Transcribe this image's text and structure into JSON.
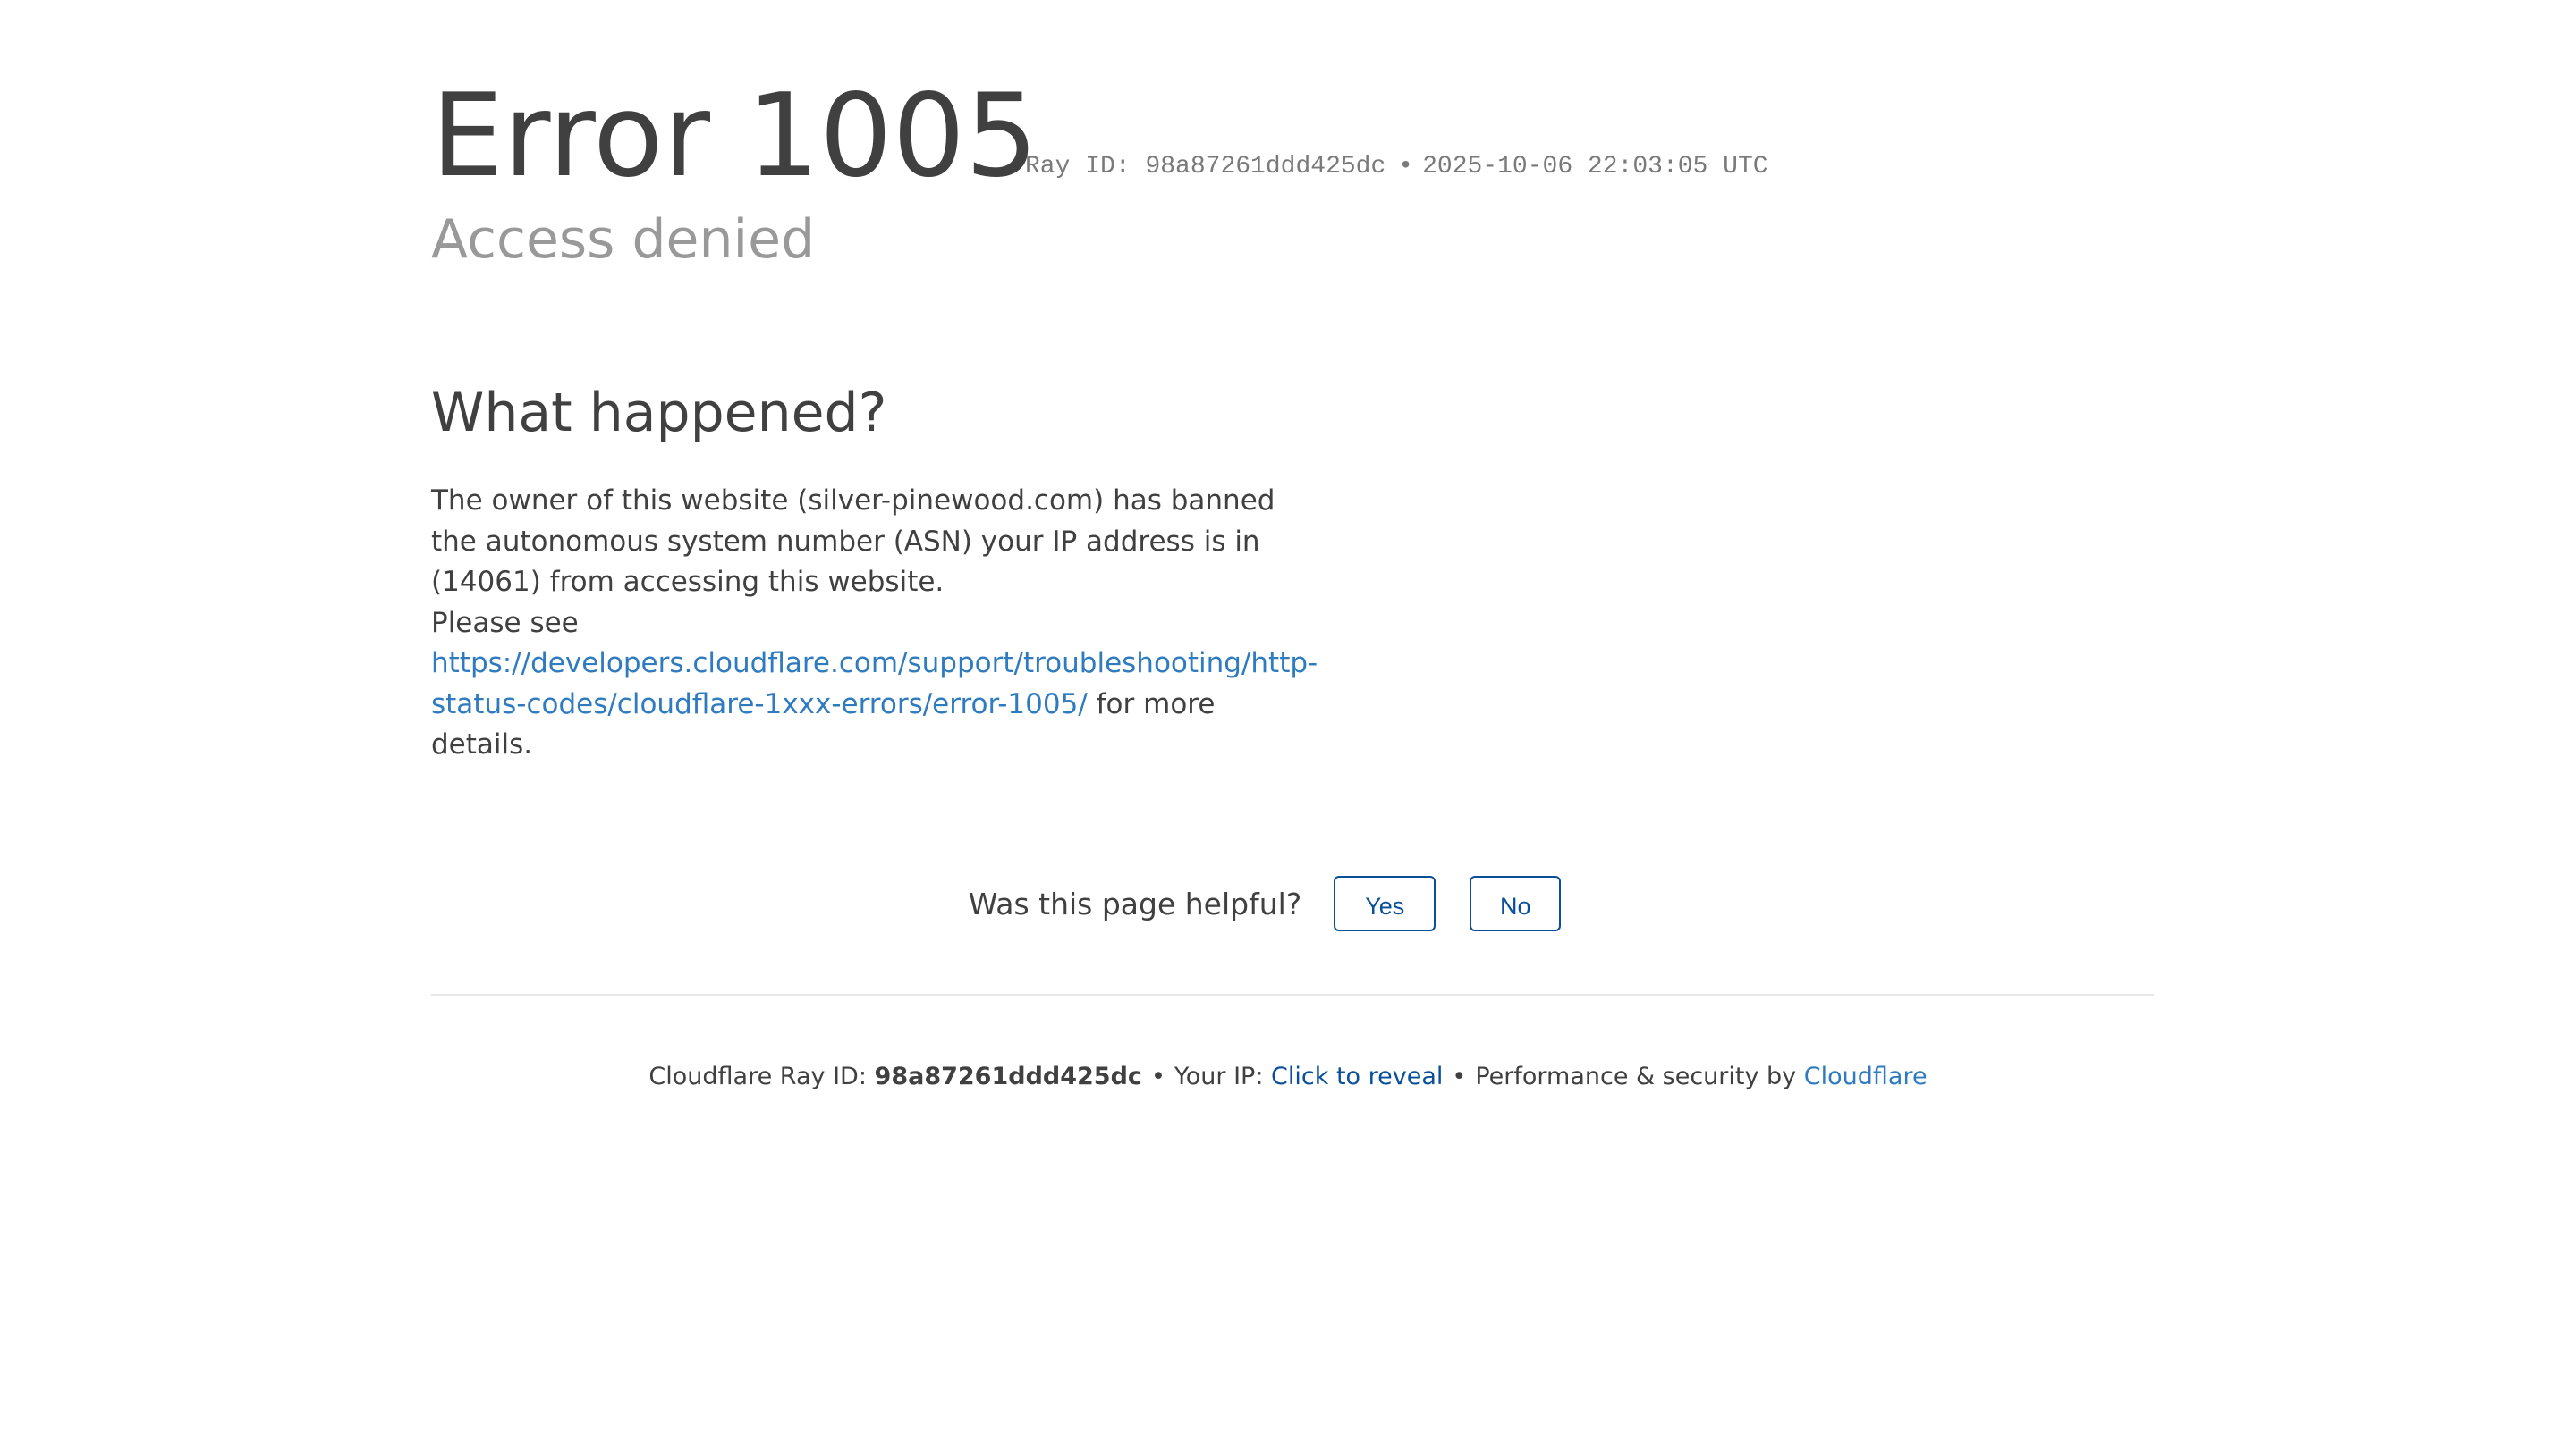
{
  "header": {
    "title": "Error 1005",
    "ray_label": "Ray ID:",
    "ray_id": "98a87261ddd425dc",
    "separator": "•",
    "timestamp": "2025-10-06 22:03:05 UTC",
    "subtitle": "Access denied"
  },
  "what_happened": {
    "heading": "What happened?",
    "paragraph": "The owner of this website (silver-pinewood.com) has banned the autonomous system number (ASN) your IP address is in (14061) from accessing this website.",
    "please_see": "Please see",
    "link_text": "https://developers.cloudflare.com/support/troubleshooting/http-status-codes/cloudflare-1xxx-errors/error-1005/",
    "after_link": "for more details."
  },
  "feedback": {
    "question": "Was this page helpful?",
    "yes_label": "Yes",
    "no_label": "No"
  },
  "footer": {
    "ray_label": "Cloudflare Ray ID:",
    "ray_id": "98a87261ddd425dc",
    "separator": "•",
    "ip_label": "Your IP:",
    "reveal_label": "Click to reveal",
    "perf_label": "Performance & security by",
    "brand_link": "Cloudflare"
  },
  "colors": {
    "text": "#404040",
    "muted": "#999999",
    "link": "#2f7bbf",
    "button": "#0a4f9a"
  }
}
